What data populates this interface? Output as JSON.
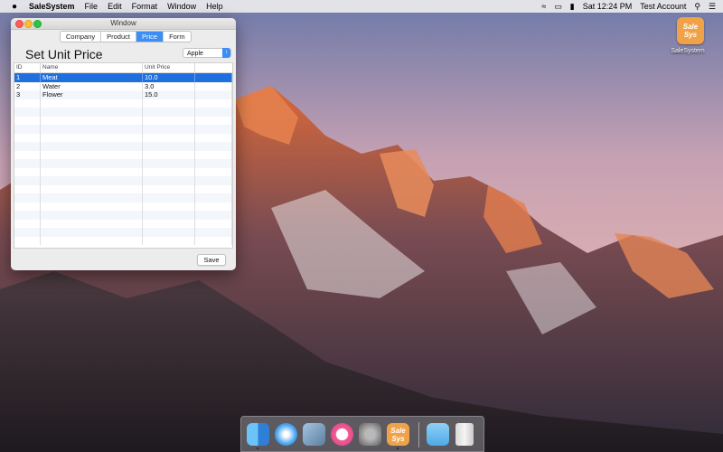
{
  "menubar": {
    "apple": "",
    "app_name": "SaleSystem",
    "menus": [
      "File",
      "Edit",
      "Format",
      "Window",
      "Help"
    ],
    "clock": "Sat 12:24 PM",
    "user": "Test Account"
  },
  "desktop_icon": {
    "title": "SaleSystem",
    "logo_line1": "Sale",
    "logo_line2": "Sys"
  },
  "window": {
    "title": "Window",
    "tabs": [
      "Company",
      "Product",
      "Price",
      "Form"
    ],
    "active_tab": "Price",
    "heading": "Set Unit Price",
    "company_select": {
      "value": "Apple"
    },
    "table": {
      "columns": [
        "ID",
        "Name",
        "Unit Price"
      ],
      "rows": [
        {
          "id": "1",
          "name": "Meat",
          "price": "10.0",
          "selected": true
        },
        {
          "id": "2",
          "name": "Water",
          "price": "3.0",
          "selected": false
        },
        {
          "id": "3",
          "name": "Flower",
          "price": "15.0",
          "selected": false
        }
      ]
    },
    "save_label": "Save"
  },
  "dock": {
    "items": [
      "finder-icon",
      "safari-icon",
      "preview-icon",
      "itunes-icon",
      "system-preferences-icon",
      "salesystem-icon",
      "folder-icon",
      "trash-icon"
    ],
    "app_logo_line1": "Sale",
    "app_logo_line2": "Sys"
  },
  "colors": {
    "accent": "#3a8ef6",
    "selection": "#1f6fdf",
    "app_icon": "#f0a248"
  }
}
